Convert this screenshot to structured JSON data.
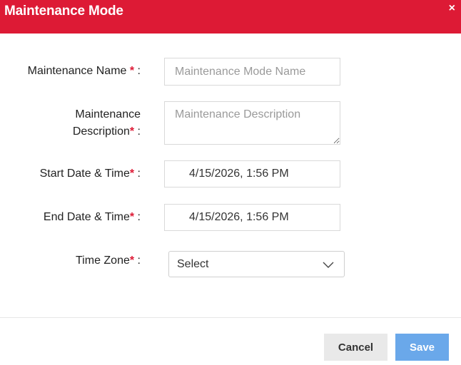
{
  "dialog": {
    "title": "Maintenance Mode",
    "close_symbol": "×"
  },
  "form": {
    "name": {
      "label": "Maintenance Name",
      "required_mark": "*",
      "suffix": " :",
      "placeholder": "Maintenance Mode Name",
      "value": ""
    },
    "description": {
      "label_line1": "Maintenance",
      "label_line2": "Description",
      "required_mark": "*",
      "suffix": " :",
      "placeholder": "Maintenance Description",
      "value": ""
    },
    "start": {
      "label": "Start Date & Time",
      "required_mark": "*",
      "suffix": " :",
      "value": "4/15/2026, 1:56 PM"
    },
    "end": {
      "label": "End Date & Time",
      "required_mark": "*",
      "suffix": " :",
      "value": "4/15/2026, 1:56 PM"
    },
    "timezone": {
      "label": "Time Zone",
      "required_mark": "*",
      "suffix": " :",
      "selected": "Select"
    }
  },
  "actions": {
    "cancel_label": "Cancel",
    "save_label": "Save"
  },
  "icons": {
    "close": "close-icon",
    "dropdown": "chevron-down-icon"
  },
  "colors": {
    "header": "#dd1a35",
    "required": "#dd1a35",
    "save_button": "#6aa8ea",
    "cancel_button": "#e9e9e9"
  }
}
